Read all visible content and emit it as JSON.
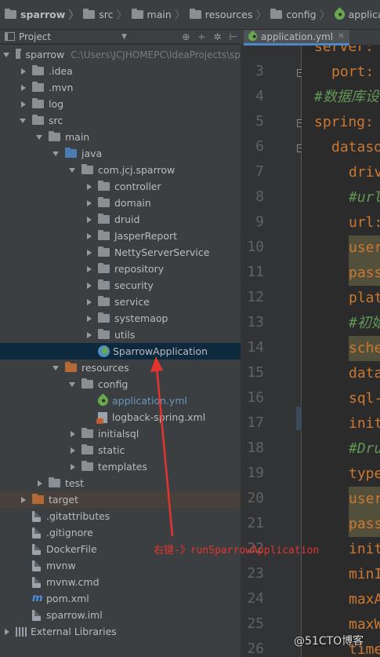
{
  "breadcrumb": [
    "sparrow",
    "src",
    "main",
    "resources",
    "config",
    "application.yml"
  ],
  "project_panel": {
    "title": "Project",
    "root_path": "C:\\Users\\JCJHOMEPC\\IdeaProjects\\sp"
  },
  "tree": [
    {
      "label": "sparrow",
      "level": 0,
      "state": "open",
      "icon": "folder-icon"
    },
    {
      "label": ".idea",
      "level": 1,
      "state": "closed",
      "icon": "folder-icon"
    },
    {
      "label": ".mvn",
      "level": 1,
      "state": "closed",
      "icon": "folder-icon"
    },
    {
      "label": "log",
      "level": 1,
      "state": "closed",
      "icon": "folder-icon"
    },
    {
      "label": "src",
      "level": 1,
      "state": "open",
      "icon": "folder-icon"
    },
    {
      "label": "main",
      "level": 2,
      "state": "open",
      "icon": "folder-icon"
    },
    {
      "label": "java",
      "level": 3,
      "state": "open",
      "icon": "source-folder-icon"
    },
    {
      "label": "com.jcj.sparrow",
      "level": 4,
      "state": "open",
      "icon": "package-icon"
    },
    {
      "label": "controller",
      "level": 5,
      "state": "closed",
      "icon": "package-icon"
    },
    {
      "label": "domain",
      "level": 5,
      "state": "closed",
      "icon": "package-icon"
    },
    {
      "label": "druid",
      "level": 5,
      "state": "closed",
      "icon": "package-icon"
    },
    {
      "label": "JasperReport",
      "level": 5,
      "state": "closed",
      "icon": "package-icon"
    },
    {
      "label": "NettyServerService",
      "level": 5,
      "state": "closed",
      "icon": "package-icon"
    },
    {
      "label": "repository",
      "level": 5,
      "state": "closed",
      "icon": "package-icon"
    },
    {
      "label": "security",
      "level": 5,
      "state": "closed",
      "icon": "package-icon"
    },
    {
      "label": "service",
      "level": 5,
      "state": "closed",
      "icon": "package-icon"
    },
    {
      "label": "systemaop",
      "level": 5,
      "state": "closed",
      "icon": "package-icon"
    },
    {
      "label": "utils",
      "level": 5,
      "state": "closed",
      "icon": "package-icon"
    },
    {
      "label": "SparrowApplication",
      "level": 5,
      "state": "leaf",
      "icon": "spring-boot-run-icon",
      "selected": true
    },
    {
      "label": "resources",
      "level": 3,
      "state": "open",
      "icon": "resources-folder-icon"
    },
    {
      "label": "config",
      "level": 4,
      "state": "open",
      "icon": "folder-icon"
    },
    {
      "label": "application.yml",
      "level": 5,
      "state": "leaf",
      "icon": "spring-yml-icon",
      "accent": true
    },
    {
      "label": "logback-spring.xml",
      "level": 5,
      "state": "leaf",
      "icon": "xml-file-icon"
    },
    {
      "label": "initialsql",
      "level": 4,
      "state": "closed",
      "icon": "folder-icon"
    },
    {
      "label": "static",
      "level": 4,
      "state": "closed",
      "icon": "folder-icon"
    },
    {
      "label": "templates",
      "level": 4,
      "state": "closed",
      "icon": "folder-icon"
    },
    {
      "label": "test",
      "level": 2,
      "state": "closed",
      "icon": "folder-icon"
    },
    {
      "label": "target",
      "level": 1,
      "state": "closed",
      "icon": "target-folder-icon",
      "excluded": true
    },
    {
      "label": ".gitattributes",
      "level": 1,
      "state": "leaf",
      "icon": "file-icon"
    },
    {
      "label": ".gitignore",
      "level": 1,
      "state": "leaf",
      "icon": "file-icon"
    },
    {
      "label": "DockerFile",
      "level": 1,
      "state": "leaf",
      "icon": "file-icon"
    },
    {
      "label": "mvnw",
      "level": 1,
      "state": "leaf",
      "icon": "file-icon"
    },
    {
      "label": "mvnw.cmd",
      "level": 1,
      "state": "leaf",
      "icon": "file-icon"
    },
    {
      "label": "pom.xml",
      "level": 1,
      "state": "leaf",
      "icon": "maven-icon"
    },
    {
      "label": "sparrow.iml",
      "level": 1,
      "state": "leaf",
      "icon": "file-icon"
    },
    {
      "label": "External Libraries",
      "level": 0,
      "state": "closed",
      "icon": "library-icon"
    }
  ],
  "editor": {
    "tab_label": "application.yml",
    "lines": [
      {
        "n": "",
        "text": "server:",
        "cls": "k",
        "indent": 0
      },
      {
        "n": "3",
        "text": "port:",
        "cls": "k",
        "indent": 1
      },
      {
        "n": "4",
        "text": "#数据库设",
        "cls": "c",
        "indent": 0
      },
      {
        "n": "5",
        "text": "spring:",
        "cls": "k",
        "indent": 0
      },
      {
        "n": "6",
        "text": "datasou",
        "cls": "k",
        "indent": 1
      },
      {
        "n": "7",
        "text": "driv",
        "cls": "k",
        "indent": 2
      },
      {
        "n": "8",
        "text": "#url",
        "cls": "c",
        "indent": 2
      },
      {
        "n": "9",
        "text": "url:",
        "cls": "k",
        "indent": 2
      },
      {
        "n": "10",
        "text": "user",
        "cls": "k hl",
        "indent": 2
      },
      {
        "n": "11",
        "text": "pass",
        "cls": "k hl",
        "indent": 2
      },
      {
        "n": "12",
        "text": "plat",
        "cls": "k",
        "indent": 2
      },
      {
        "n": "13",
        "text": "#初始",
        "cls": "c",
        "indent": 2
      },
      {
        "n": "14",
        "text": "sche",
        "cls": "k hl",
        "indent": 2
      },
      {
        "n": "15",
        "text": "data",
        "cls": "k",
        "indent": 2
      },
      {
        "n": "16",
        "text": "sql-",
        "cls": "k",
        "indent": 2
      },
      {
        "n": "17",
        "text": "init",
        "cls": "k",
        "indent": 2
      },
      {
        "n": "18",
        "text": "#Dru",
        "cls": "c",
        "indent": 2
      },
      {
        "n": "19",
        "text": "type",
        "cls": "k",
        "indent": 2
      },
      {
        "n": "20",
        "text": "user",
        "cls": "k hl",
        "indent": 2
      },
      {
        "n": "21",
        "text": "pass",
        "cls": "k hl",
        "indent": 2
      },
      {
        "n": "22",
        "text": "init",
        "cls": "k",
        "indent": 2
      },
      {
        "n": "23",
        "text": "minI",
        "cls": "k",
        "indent": 2
      },
      {
        "n": "24",
        "text": "maxA",
        "cls": "k",
        "indent": 2
      },
      {
        "n": "25",
        "text": "maxW",
        "cls": "k",
        "indent": 2
      },
      {
        "n": "26",
        "text": "time",
        "cls": "k",
        "indent": 2
      }
    ]
  },
  "annotation": {
    "text": "右键-》runSparrowApplication",
    "color": "#e3342f"
  },
  "watermark": "@51CTO博客",
  "colors": {
    "panel_bg": "#3c3f41",
    "editor_bg": "#2b2b2b",
    "selection": "#0d293e",
    "keyword": "#cc7832",
    "comment": "#629755",
    "annotation": "#e3342f"
  }
}
